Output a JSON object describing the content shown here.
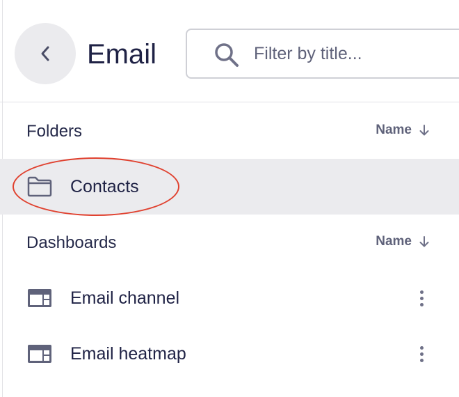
{
  "header": {
    "title": "Email",
    "back_icon": "chevron-left-icon",
    "search": {
      "placeholder": "Filter by title...",
      "value": "",
      "icon": "search-icon"
    }
  },
  "folders_section": {
    "title": "Folders",
    "sort_label": "Name",
    "sort_icon": "arrow-down-icon",
    "items": [
      {
        "label": "Contacts",
        "icon": "folder-icon",
        "selected": true
      }
    ]
  },
  "dashboards_section": {
    "title": "Dashboards",
    "sort_label": "Name",
    "sort_icon": "arrow-down-icon",
    "items": [
      {
        "label": "Email channel",
        "icon": "dashboard-icon",
        "menu_icon": "more-vertical-icon"
      },
      {
        "label": "Email heatmap",
        "icon": "dashboard-icon",
        "menu_icon": "more-vertical-icon"
      }
    ]
  },
  "colors": {
    "text": "#262a4a",
    "muted": "#5f627a",
    "selected_row": "#ebebee",
    "annotation": "#e0412f"
  }
}
